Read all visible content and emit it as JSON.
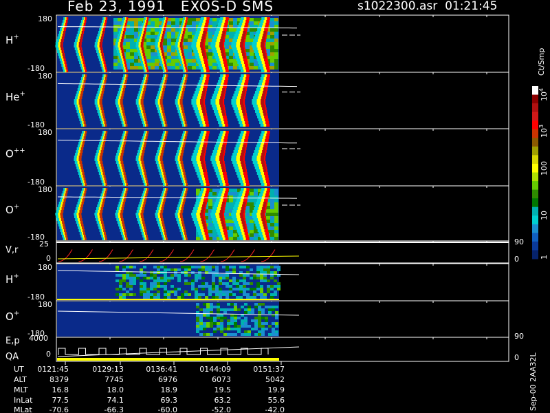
{
  "header": {
    "date": "Feb 23, 1991",
    "instrument": "EXOS-D SMS",
    "file": "s1022300.asr",
    "time": "01:21:45"
  },
  "panels": [
    {
      "id": "h",
      "label": "H",
      "sup": "+",
      "ymax": "180",
      "ymin": "-180"
    },
    {
      "id": "he",
      "label": "He",
      "sup": "+",
      "ymax": "180",
      "ymin": "-180"
    },
    {
      "id": "opp",
      "label": "O",
      "sup": "++",
      "ymax": "180",
      "ymin": "-180"
    },
    {
      "id": "op",
      "label": "O",
      "sup": "+",
      "ymax": "180",
      "ymin": "-180"
    }
  ],
  "vr_panel": {
    "label": "V,r",
    "ymax": "25",
    "ymin": "0",
    "right_top": "90",
    "right_bottom": "0"
  },
  "hsm_panel": {
    "label": "H",
    "sup": "+",
    "ymax": "180",
    "ymin": "-180"
  },
  "osm_panel": {
    "label": "O",
    "sup": "+",
    "ymax": "180",
    "ymin": "-180"
  },
  "ep_panel": {
    "label": "E,p",
    "label2": "QA",
    "ymax": "4000",
    "ymin": "0",
    "right_top": "90",
    "right_bottom": "0"
  },
  "colorbar": {
    "unit": "Ct/Smp",
    "ticks": [
      {
        "base": "10",
        "exp": "4"
      },
      {
        "base": "10",
        "exp": "3"
      },
      {
        "base": "100",
        "exp": ""
      },
      {
        "base": "10",
        "exp": ""
      },
      {
        "base": "1",
        "exp": ""
      }
    ],
    "colors": [
      "#ffffff",
      "#8b0000",
      "#b01010",
      "#d01818",
      "#ff0000",
      "#cc3300",
      "#8b5a00",
      "#a0a000",
      "#d8d800",
      "#ffff00",
      "#b0e000",
      "#66cc00",
      "#2e8b00",
      "#007700",
      "#00b0b0",
      "#00d0d0",
      "#1a8fd0",
      "#1060c0",
      "#0a3a9a",
      "#06226a"
    ]
  },
  "ephemeris": {
    "labels": [
      "UT",
      "ALT",
      "MLT",
      "InLat",
      "MLat"
    ],
    "columns": [
      {
        "UT": "0121:45",
        "ALT": "8379",
        "MLT": "16.8",
        "InLat": "77.5",
        "MLat": "-70.6"
      },
      {
        "UT": "0129:13",
        "ALT": "7745",
        "MLT": "18.0",
        "InLat": "74.1",
        "MLat": "-66.3"
      },
      {
        "UT": "0136:41",
        "ALT": "6976",
        "MLT": "18.9",
        "InLat": "69.3",
        "MLat": "-60.0"
      },
      {
        "UT": "0144:09",
        "ALT": "6073",
        "MLT": "19.5",
        "InLat": "63.2",
        "MLat": "-52.0"
      },
      {
        "UT": "0151:37",
        "ALT": "5042",
        "MLT": "19.9",
        "InLat": "55.6",
        "MLat": "-42.0"
      }
    ]
  },
  "footer_rotated": "Sep-00  2AA32L"
}
